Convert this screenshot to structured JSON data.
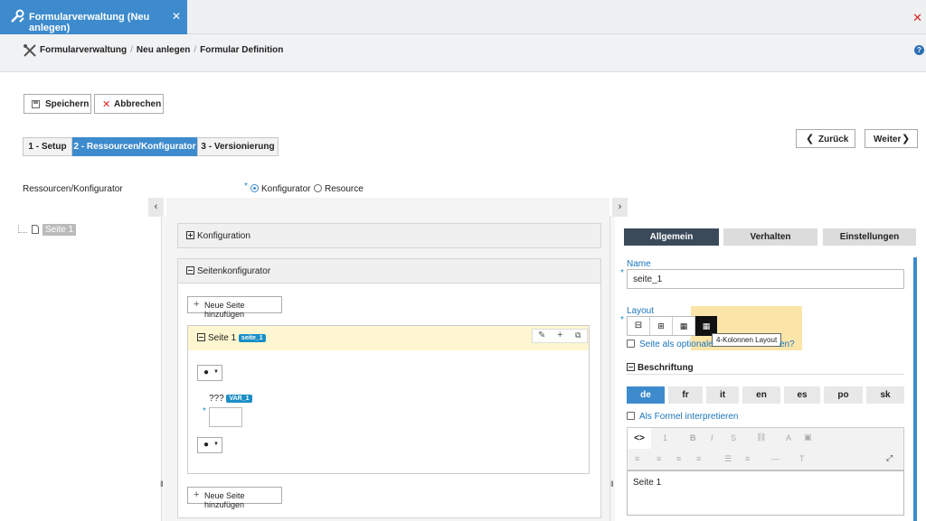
{
  "tab": {
    "title": "Formularverwaltung (Neu anlegen)",
    "close": "✕"
  },
  "window_close": "✕",
  "breadcrumb": [
    "Formularverwaltung",
    "Neu anlegen",
    "Formular Definition"
  ],
  "help": "?",
  "actions": {
    "save": "Speichern",
    "cancel": "Abbrechen"
  },
  "steps": [
    "1 - Setup",
    "2 - Ressourcen/Konfigurator",
    "3 - Versionierung"
  ],
  "nav": {
    "back": "Zurück",
    "next": "Weiter"
  },
  "resource_row": {
    "label": "Ressourcen/Konfigurator",
    "options": [
      "Konfigurator",
      "Resource"
    ],
    "selected": "Konfigurator"
  },
  "tree": {
    "item": "Seite 1"
  },
  "center": {
    "konfiguration": "Konfiguration",
    "seitenkonfigurator": "Seitenkonfigurator",
    "add_page": "Neue Seite hinzufügen",
    "page_title": "Seite 1",
    "page_badge": "seite_1",
    "var_label": "???",
    "var_badge": "VAR_1"
  },
  "right": {
    "tabs": [
      "Allgemein",
      "Verhalten",
      "Einstellungen"
    ],
    "name_label": "Name",
    "name_value": "seite_1",
    "layout_label": "Layout",
    "tooltip": "4-Kolonnen Layout",
    "optional_text": "Seite als optionale",
    "optional_tail": "en?",
    "beschriftung": "Beschriftung",
    "langs": [
      "de",
      "fr",
      "it",
      "en",
      "es",
      "po",
      "sk"
    ],
    "formula": "Als Formel interpretieren",
    "editor_text": "Seite 1"
  }
}
